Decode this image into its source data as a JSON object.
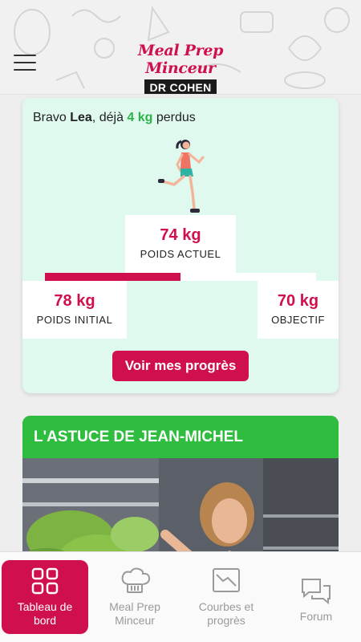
{
  "header": {
    "logo_title": "Meal Prep Minceur",
    "logo_badge": "DR COHEN",
    "menu_icon": "hamburger-menu-icon"
  },
  "progress": {
    "greeting_prefix": "Bravo ",
    "user_name": "Lea",
    "greeting_mid": ", déjà ",
    "lost_amount": "4 kg",
    "greeting_suffix": " perdus",
    "current_weight": "74 kg",
    "current_label": "POIDS ACTUEL",
    "initial_weight": "78 kg",
    "initial_label": "POIDS INITIAL",
    "goal_weight": "70 kg",
    "goal_label": "OBJECTIF",
    "progress_fraction": 0.5,
    "button_label": "Voir mes progrès"
  },
  "tip": {
    "title": "L'ASTUCE DE JEAN-MICHEL"
  },
  "tabs": [
    {
      "line1": "Tableau de",
      "line2": "bord",
      "icon": "dashboard-grid-icon",
      "active": true
    },
    {
      "line1": "Meal Prep",
      "line2": "Minceur",
      "icon": "chef-hat-icon",
      "active": false
    },
    {
      "line1": "Courbes et",
      "line2": "progrès",
      "icon": "chart-icon",
      "active": false
    },
    {
      "line1": "Forum",
      "line2": "",
      "icon": "chat-bubbles-icon",
      "active": false
    }
  ],
  "colors": {
    "brand": "#d0104c",
    "green": "#2bb34a",
    "card_bg": "#dff9ef",
    "tip_header": "#2ebd3f"
  }
}
